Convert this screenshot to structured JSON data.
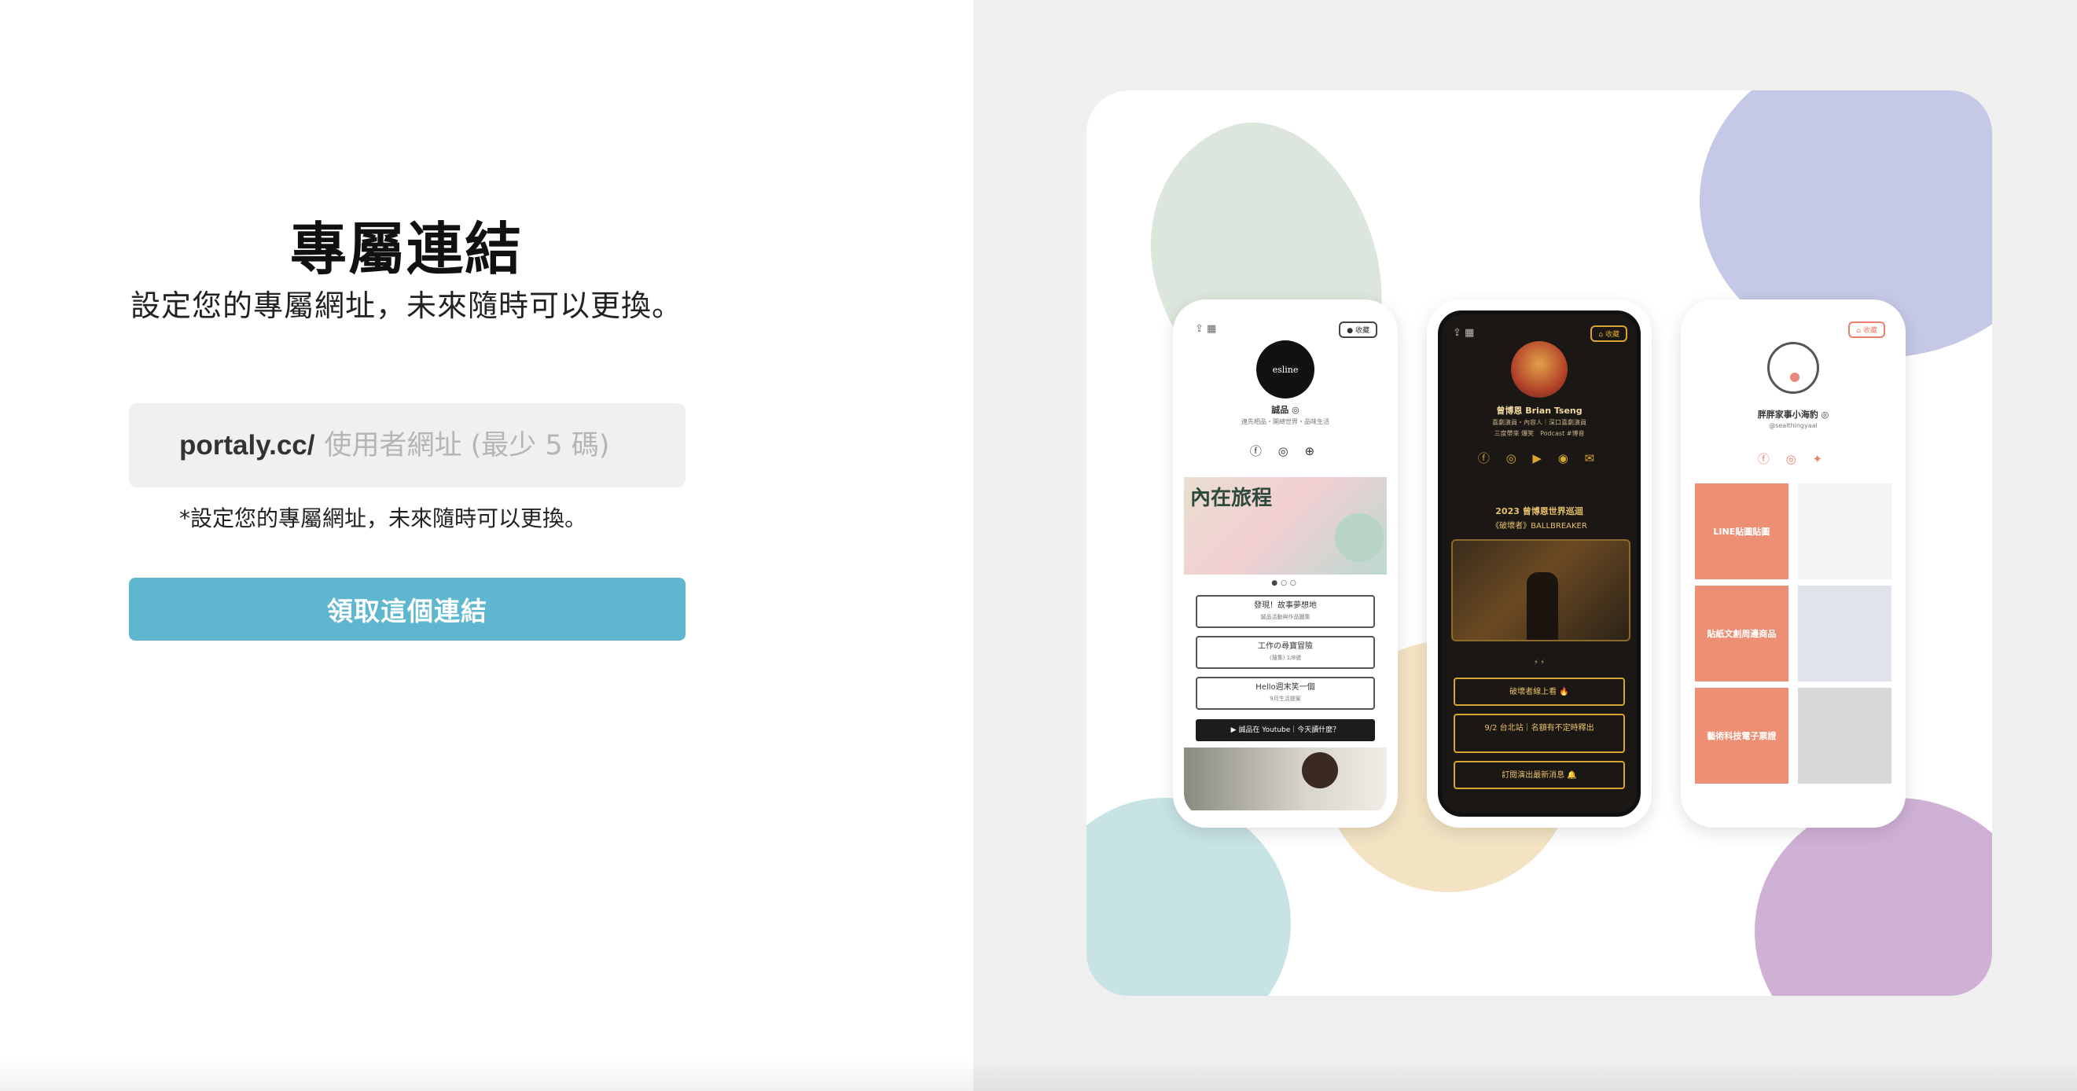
{
  "form": {
    "title": "專屬連結",
    "subtitle": "設定您的專屬網址，未來隨時可以更換。",
    "url_prefix": "portaly.cc/",
    "url_placeholder": "使用者網址 (最少 5 碼)",
    "url_value": "",
    "helper_text": "*設定您的專屬網址，未來隨時可以更換。",
    "claim_button_label": "領取這個連結"
  },
  "preview": {
    "phone1": {
      "avatar_text": "esline",
      "name": "誠品 ◎",
      "desc": "連先相品・開總世界・品味生活",
      "banner_title": "內在旅程",
      "buttons": [
        {
          "label": "發現！故事夢想地",
          "sub": "誠品活動與作品圖集"
        },
        {
          "label": "工作の尋寶冒險",
          "sub": "(搜集) 1/8號"
        },
        {
          "label": "Hello週末笑一個",
          "sub": "9月生活提案"
        }
      ],
      "dark_button": "▶ 誠品在 Youtube｜今天讀什麼？"
    },
    "phone2": {
      "name": "曾博恩 Brian Tseng",
      "desc": "喜劇演員・內容人｜深口喜劇演員",
      "desc2": "三度帶來 爆笑　Podcast #博音",
      "headline": "2023 曾博恩世界巡迴",
      "headline2": "《破壞者》BALLBREAKER",
      "buttons": [
        "破壞者線上看 🔥",
        "9/2 台北站｜名額有不定時釋出",
        "訂閱演出最新消息 🔔"
      ]
    },
    "phone3": {
      "name": "胖胖家事小海豹 ◎",
      "handle": "@sealthingyaal",
      "tiles": [
        "LINE貼圖貼圖",
        "貼紙文創周邊商品",
        "藝術科技電子票證"
      ]
    }
  },
  "colors": {
    "accent": "#5eb6cf",
    "right_panel_bg": "#efefef",
    "input_bg": "#f0f0f0"
  }
}
